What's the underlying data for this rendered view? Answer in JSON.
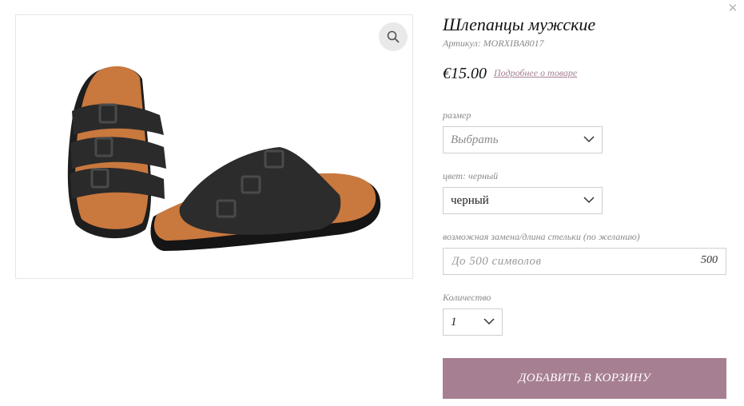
{
  "modal": {
    "close_icon": "close-icon"
  },
  "product": {
    "title": "Шлепанцы мужские",
    "sku": "Артикул: MORXIBA8017",
    "price": "€15.00",
    "details_link": "Подробнее о товаре",
    "image_icon": "sandals-image",
    "zoom_icon": "search-icon"
  },
  "options": {
    "size_label": "размер",
    "size_value": "Выбрать",
    "color_label": "цвет: черный",
    "color_value": "черный",
    "insole_label": "возможная замена/длина стельки (по желанию)",
    "insole_placeholder": "До 500 символов",
    "insole_counter": "500",
    "quantity_label": "Количество",
    "quantity_value": "1"
  },
  "cart": {
    "add_label": "ДОБАВИТЬ В КОРЗИНУ"
  },
  "colors": {
    "accent": "#a77f92",
    "link": "#a47f93",
    "border": "#cfcfcf"
  }
}
